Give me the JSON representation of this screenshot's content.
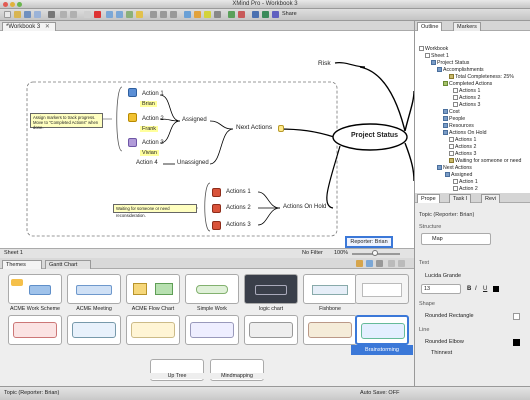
{
  "window": {
    "title": "XMind Pro - Workbook 3"
  },
  "toolbar": {
    "share_label": "Share"
  },
  "editor": {
    "tab_label": "*Workbook 3"
  },
  "map": {
    "central": "Project Status",
    "risk": "Risk",
    "next_actions": "Next Actions",
    "assigned": "Assigned",
    "unassigned": "Unassigned",
    "actions_on_hold": "Actions On Hold",
    "action1": "Action 1",
    "action2": "Action 2",
    "action3": "Action 3",
    "action4": "Action 4",
    "brian": "Brian",
    "frank": "Frank",
    "vivian": "Vivian",
    "note1_line1": "Assign markers to track progress.",
    "note1_line2": "Move to \"Completed Actions\" when done.",
    "note2": "Waiting for someone or need reconsideration.",
    "hold1": "Actions 1",
    "hold2": "Actions 2",
    "hold3": "Actions 3",
    "reporter": "Reporter: Brian"
  },
  "sheetbar": {
    "sheet": "Sheet 1",
    "filter": "No Filter",
    "zoom": "100%"
  },
  "themes": {
    "tab_themes": "Themes",
    "tab_gantt": "Gantt Chart",
    "items": [
      "ACME Work Scheme",
      "ACME Meeting",
      "ACME Flow Chart",
      "Simple Work",
      "logic chart",
      "Fishbone",
      "Brainstorming"
    ],
    "row2": [
      "Up Tree",
      "Mindmapping"
    ]
  },
  "outline": {
    "tab_outline": "Outline",
    "tab_markers": "Markers",
    "items": [
      "Workbook",
      "Sheet 1",
      "Project Status",
      "Accomplishments",
      "Total Completeness: 25%",
      "Completed Actions",
      "Actions 1",
      "Actions 2",
      "Actions 3",
      "Cost",
      "People",
      "Resources",
      "Actions On Hold",
      "Actions 1",
      "Actions 2",
      "Actions 3",
      "Waiting for someone or need",
      "Next Actions",
      "Assigned",
      "Action 1",
      "Action 2"
    ]
  },
  "properties": {
    "tab_prop": "Prope",
    "tab_task": "Task I",
    "tab_revi": "Revi",
    "topic_title": "Topic (Reporter: Brian)",
    "structure_label": "Structure",
    "structure_value": "Map",
    "text_label": "Text",
    "font_value": "Lucida Grande",
    "size_value": "13",
    "shape_label": "Shape",
    "shape_value": "Rounded Rectangle",
    "line_label": "Line",
    "line_value": "Rounded Elbow",
    "thickness_value": "Thinnest"
  },
  "status": {
    "left": "Topic (Reporter: Brian)",
    "right": "Auto Save: OFF"
  },
  "colors": {
    "selected_theme": "#3b78d8",
    "central_border": "#000000",
    "note_yellow": "#ffffc0"
  }
}
